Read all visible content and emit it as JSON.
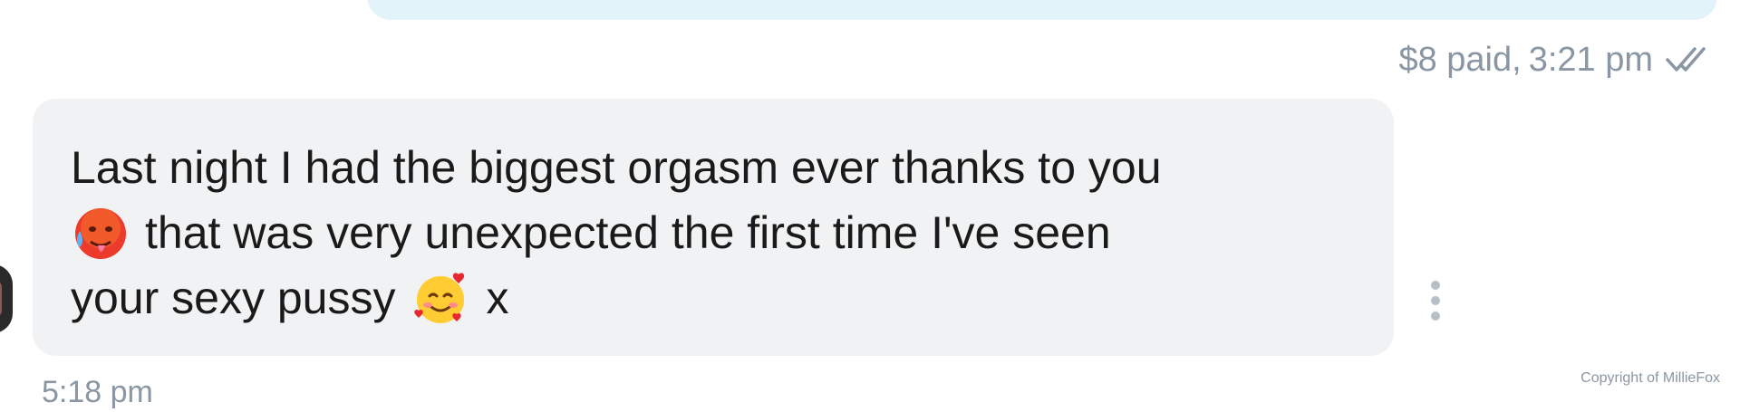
{
  "sent_message": {
    "price": "$8 paid",
    "separator": ",",
    "time": "3:21 pm",
    "status_icon": "double-check-icon"
  },
  "received_message": {
    "line1": "Last night I had the biggest orgasm ever thanks to you",
    "line2": "that was very unexpected the first time I've seen",
    "line3_text": "your sexy pussy",
    "line3_end": "x",
    "emoji1": "hot-face-emoji",
    "emoji2": "smiling-face-with-hearts-emoji",
    "time": "5:18 pm"
  },
  "watermark": "Copyright of MillieFox",
  "colors": {
    "sent_bubble": "#e2f3fa",
    "received_bubble": "#f1f2f3",
    "meta_text": "#8a96a3",
    "message_text": "#1a1a1a"
  }
}
